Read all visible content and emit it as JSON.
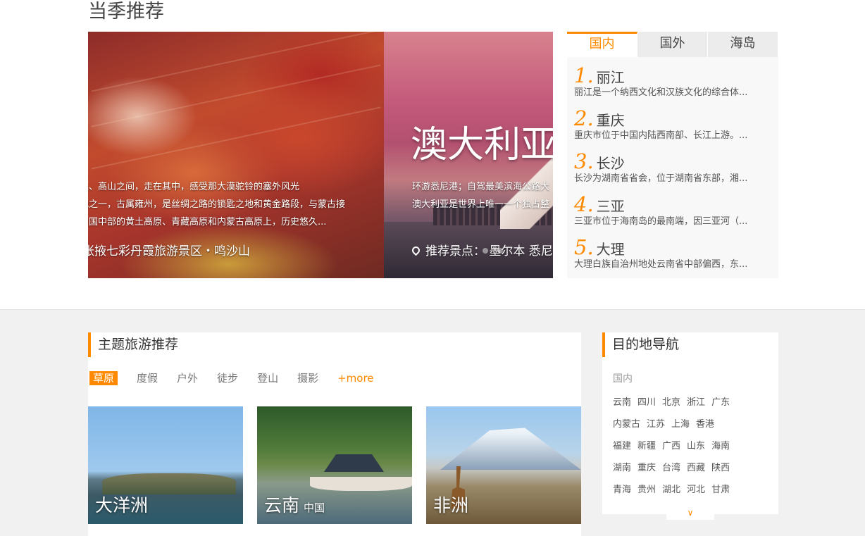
{
  "season": {
    "title": "当季推荐",
    "slide_a": {
      "lines": [
        "莫、高山之间，走在其中，感受那大漠驼铃的塞外风光",
        "地之一，古属雍州，是丝绸之路的锁匙之地和黄金路段，与蒙古接",
        "中国中部的黄土高原、青藏高原和内蒙古高原上，历史悠久..."
      ],
      "bottom": "张掖七彩丹霞旅游景区・鸣沙山"
    },
    "slide_b": {
      "title": "澳大利亚",
      "lines": [
        "环游悉尼港；自驾最美滨海公路大",
        "澳大利亚是世界上唯一一个独占整"
      ],
      "bottom": "推荐景点：  墨尔本 悉尼 黄金海岸"
    }
  },
  "rank": {
    "tabs": [
      "国内",
      "国外",
      "海岛"
    ],
    "items": [
      {
        "num": "1.",
        "name": "丽江",
        "desc": "丽江是一个纳西文化和汉族文化的综合体..."
      },
      {
        "num": "2.",
        "name": "重庆",
        "desc": "重庆市位于中国内陆西南部、长江上游。..."
      },
      {
        "num": "3.",
        "name": "长沙",
        "desc": "长沙为湖南省省会，位于湖南省东部，湘..."
      },
      {
        "num": "4.",
        "name": "三亚",
        "desc": "三亚市位于海南岛的最南端，因三亚河（..."
      },
      {
        "num": "5.",
        "name": "大理",
        "desc": "大理白族自治州地处云南省中部偏西，东..."
      }
    ]
  },
  "theme": {
    "title": "主题旅游推荐",
    "tabs": [
      "草原",
      "度假",
      "户外",
      "徒步",
      "登山",
      "摄影",
      "+more"
    ],
    "cards": [
      {
        "label": "大洋洲",
        "sub": ""
      },
      {
        "label": "云南",
        "sub": "中国"
      },
      {
        "label": "非洲",
        "sub": ""
      }
    ]
  },
  "dest": {
    "title": "目的地导航",
    "category": "国内",
    "rows": [
      [
        "云南",
        "四川",
        "北京",
        "浙江",
        "广东"
      ],
      [
        "内蒙古",
        "江苏",
        "上海",
        "香港"
      ],
      [
        "福建",
        "新疆",
        "广西",
        "山东",
        "海南"
      ],
      [
        "湖南",
        "重庆",
        "台湾",
        "西藏",
        "陕西"
      ],
      [
        "青海",
        "贵州",
        "湖北",
        "河北",
        "甘肃"
      ]
    ],
    "toggle_icon": "chevron-down-icon"
  },
  "colors": {
    "accent": "#ff8a00",
    "page_bg": "#f1f1f1"
  }
}
